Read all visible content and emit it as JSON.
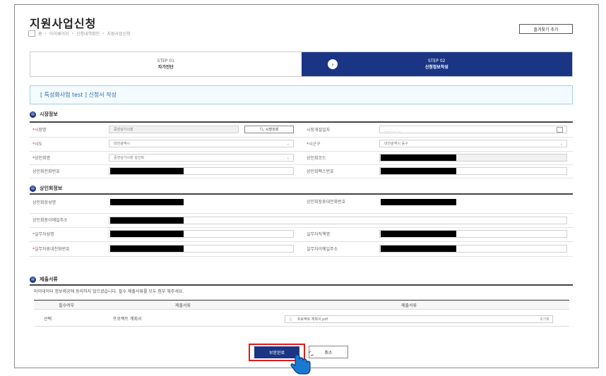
{
  "header": {
    "title": "지원사업신청",
    "breadcrumb": [
      "홈",
      "마이페이지",
      "신청내역확인",
      "지원사업신청"
    ],
    "favorite_button": "즐겨찾기 추가"
  },
  "steps": [
    {
      "step": "STEP 01",
      "label": "자가진단",
      "active": false
    },
    {
      "step": "STEP 02",
      "label": "신청정보작성",
      "active": true
    }
  ],
  "notice": "[ 특성화사업 test ] 신청서 작성",
  "market_section": {
    "title": "시장정보",
    "rows": [
      {
        "label1": "시장명",
        "value1": "중앙상가시장",
        "search": "시장조회",
        "label2": "시장개설일자",
        "value2": "____-__-__"
      },
      {
        "label1": "시도",
        "value1": "대전광역시",
        "label2": "시군구",
        "value2": "대전광역시 동구"
      },
      {
        "label1": "상인회명",
        "value1": "중앙상가시장 상인회",
        "label2": "상인회코드",
        "value2": ""
      },
      {
        "label1": "상인회전화번호",
        "value1": "",
        "label2": "상인회팩스번호",
        "value2": ""
      }
    ]
  },
  "merchant_section": {
    "title": "상인회정보",
    "rows": [
      {
        "label1": "상인회장성명",
        "label2": "상인회장휴대전화번호"
      },
      {
        "label1": "상인회장이메일주소"
      },
      {
        "label1": "실무자성명",
        "label2": "실무자직책명"
      },
      {
        "label1": "실무자휴대전화번호",
        "label2": "실무자이메일주소"
      }
    ]
  },
  "submit_section": {
    "title": "제출서류",
    "description": "마이데이터 정보제공에 동의하지 않으셨습니다. 필수 제출서류를 모두 첨부 해주세요.",
    "columns": [
      "필수여부",
      "제출서류",
      "제출서류"
    ],
    "rows": [
      {
        "required": "선택",
        "doc_name": "프로젝트 계획서",
        "file": "프로젝트 계획서.pdf",
        "delete": "초기화"
      }
    ]
  },
  "actions": {
    "save": "보완완료",
    "cancel": "취소"
  },
  "colors": {
    "primary": "#1b3585",
    "highlight": "#e01a1a",
    "notice_border": "#9fd2ea"
  }
}
